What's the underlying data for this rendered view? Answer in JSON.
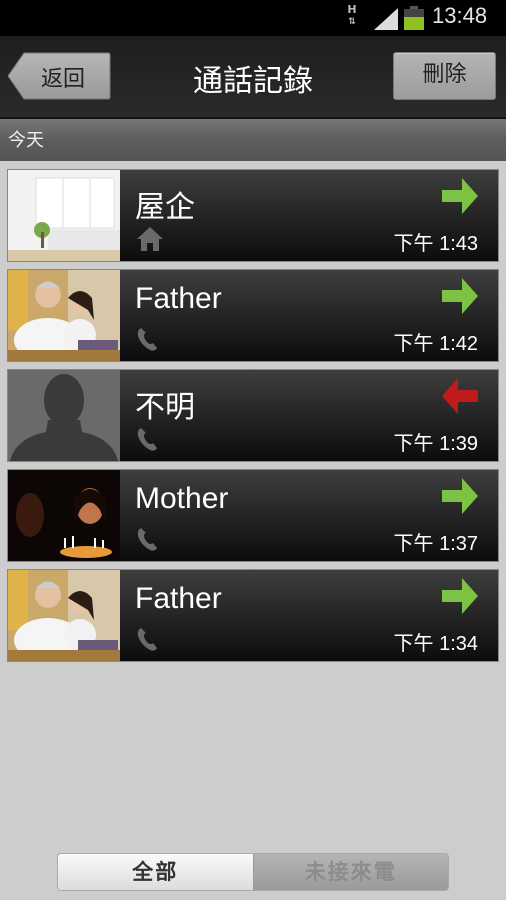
{
  "status_bar": {
    "network_label": "H",
    "time": "13:48",
    "battery_color": "#8dc21f"
  },
  "header": {
    "back_label": "返回",
    "title": "通話記錄",
    "delete_label": "刪除"
  },
  "section_label": "今天",
  "colors": {
    "outgoing": "#7dc243",
    "missed": "#c01b1b"
  },
  "calls": [
    {
      "name": "屋企",
      "type_icon": "home-icon",
      "direction": "outgoing",
      "time": "下午 1:43",
      "photo": "living-room"
    },
    {
      "name": "Father",
      "type_icon": "phone-icon",
      "direction": "outgoing",
      "time": "下午 1:42",
      "photo": "father"
    },
    {
      "name": "不明",
      "type_icon": "phone-icon",
      "direction": "missed",
      "time": "下午 1:39",
      "photo": "unknown-silhouette"
    },
    {
      "name": "Mother",
      "type_icon": "phone-icon",
      "direction": "outgoing",
      "time": "下午 1:37",
      "photo": "mother"
    },
    {
      "name": "Father",
      "type_icon": "phone-icon",
      "direction": "outgoing",
      "time": "下午 1:34",
      "photo": "father"
    }
  ],
  "filter_tabs": [
    {
      "label": "全部",
      "selected": true
    },
    {
      "label": "未接來電",
      "selected": false
    }
  ]
}
